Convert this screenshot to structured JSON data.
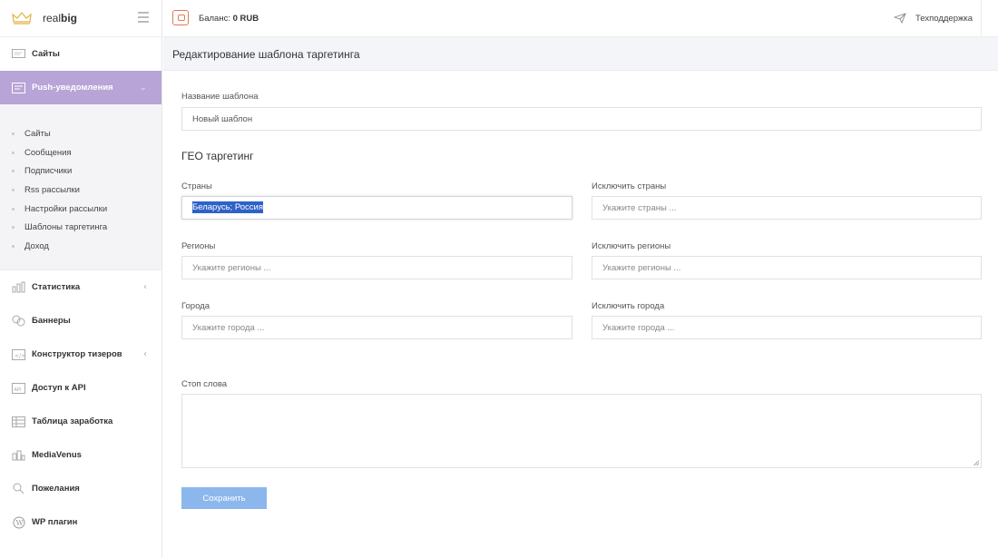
{
  "brand": {
    "name_light": "real",
    "name_bold": "big",
    "accent_color": "#b8a4d6"
  },
  "topbar": {
    "balance_label": "Баланс: ",
    "balance_value": "0 RUB",
    "support_label": "Техподдержка"
  },
  "sidebar": {
    "sites": {
      "label": "Сайты",
      "icon": "monitor-icon"
    },
    "push": {
      "label": "Push-уведомления",
      "icon": "push-icon"
    },
    "sub_items": [
      {
        "label": "Сайты"
      },
      {
        "label": "Сообщения"
      },
      {
        "label": "Подписчики"
      },
      {
        "label": "Rss рассылки"
      },
      {
        "label": "Настройки рассылки"
      },
      {
        "label": "Шаблоны таргетинга"
      },
      {
        "label": "Доход"
      }
    ],
    "items": [
      {
        "label": "Статистика",
        "icon": "stats-icon",
        "has_chevron": true
      },
      {
        "label": "Баннеры",
        "icon": "banners-icon",
        "has_chevron": false
      },
      {
        "label": "Конструктор тизеров",
        "icon": "code-icon",
        "has_chevron": true
      },
      {
        "label": "Доступ к API",
        "icon": "api-icon",
        "has_chevron": false
      },
      {
        "label": "Таблица заработка",
        "icon": "table-icon",
        "has_chevron": false
      },
      {
        "label": "MediaVenus",
        "icon": "mediavenus-icon",
        "has_chevron": false
      },
      {
        "label": "Пожелания",
        "icon": "wishes-icon",
        "has_chevron": false
      },
      {
        "label": "WP плагин",
        "icon": "wordpress-icon",
        "has_chevron": false
      }
    ]
  },
  "page": {
    "title": "Редактирование шаблона таргетинга",
    "template_name": {
      "label": "Название шаблона",
      "value": "Новый шаблон"
    },
    "geo_title": "ГЕО таргетинг",
    "countries": {
      "label": "Страны",
      "value": "Беларусь; Россия"
    },
    "exclude_countries": {
      "label": "Исключить страны",
      "placeholder": "Укажите страны ..."
    },
    "regions": {
      "label": "Регионы",
      "placeholder": "Укажите регионы ..."
    },
    "exclude_regions": {
      "label": "Исключить регионы",
      "placeholder": "Укажите регионы ..."
    },
    "cities": {
      "label": "Города",
      "placeholder": "Укажите города ..."
    },
    "exclude_cities": {
      "label": "Исключить города",
      "placeholder": "Укажите города ..."
    },
    "stop_words": {
      "label": "Стоп слова",
      "value": ""
    },
    "save_label": "Сохранить"
  }
}
